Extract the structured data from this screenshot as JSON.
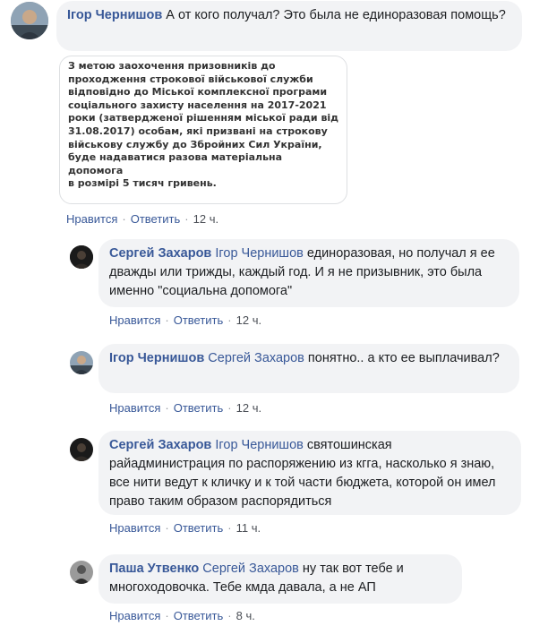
{
  "comments": [
    {
      "author": "Ігор Чернишов",
      "mention": "",
      "text": "А от кого получал? Это была не единоразовая помощь?",
      "like_label": "Нравится",
      "reply_label": "Ответить",
      "time": "12 ч.",
      "attachment_text": "З метою заохочення призовників до\nпроходження строкової військової служби\nвідповідно до Міської комплексної програми\nсоціального захисту населення на 2017-2021\nроки (затвердженої рішенням міської ради від\n31.08.2017) особам, які призвані на строкову\nвійськову службу до Збройних Сил України,\nбуде надаватися разова матеріальна допомога\nв розмірі 5 тисяч гривень."
    },
    {
      "author": "Сергей Захаров",
      "mention": "Ігор Чернишов",
      "text": "единоразовая, но получал я ее дважды или трижды, каждый год. И я не призывник, это была именно \"социальна допомога\"",
      "like_label": "Нравится",
      "reply_label": "Ответить",
      "time": "12 ч."
    },
    {
      "author": "Ігор Чернишов",
      "mention": "Сергей Захаров",
      "text": "понятно.. а кто ее выплачивал?",
      "like_label": "Нравится",
      "reply_label": "Ответить",
      "time": "12 ч."
    },
    {
      "author": "Сергей Захаров",
      "mention": "Ігор Чернишов",
      "text": "святошинская райадминистрация по распоряжению из кгга, насколько я знаю, все нити ведут к кличку и к той части бюджета, которой он имел право таким образом распорядиться",
      "like_label": "Нравится",
      "reply_label": "Ответить",
      "time": "11 ч."
    },
    {
      "author": "Паша Утвенко",
      "mention": "Сергей Захаров",
      "text": "ну так вот тебе и многоходовочка. Тебе кмда давала, а не АП",
      "like_label": "Нравится",
      "reply_label": "Ответить",
      "time": "8 ч."
    }
  ],
  "colors": {
    "link": "#385898",
    "bubble": "#f2f3f5",
    "meta": "#4b4f56"
  }
}
